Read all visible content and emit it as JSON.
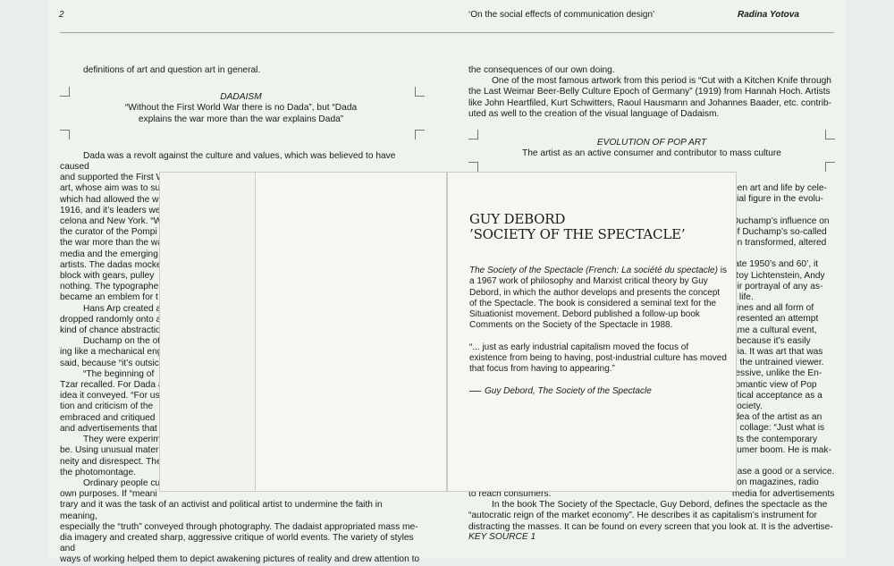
{
  "header": {
    "page_number": "2",
    "title": "‘On the social effects of communication design’",
    "author": "Radina Yotova"
  },
  "left": {
    "intro": "definitions of art and question art in general.",
    "dadaism_heading": "DADAISM",
    "dadaism_quote_1": "“Without the First World War there is no Dada”, but “Dada",
    "dadaism_quote_2": "explains the war more than the war explains Dada”",
    "lines": [
      "Dada was a revolt against the culture and values, which was believed to have caused",
      "and supported the First World War. (1914-18) It quickly developed into type of avant-gard",
      "art, whose aim was to su",
      "which had allowed the w",
      "1916, and it’s leaders we",
      "celona and New York. “W",
      "the curator of the Pompi",
      "the war more than the wa",
      "media and the emerging",
      "artists. The dadas mocke",
      "block with gears, pulley",
      "nothing. The typographe",
      "became an emblem for t",
      "Hans Arp created a",
      "dropped randomly onto a",
      "kind of chance abstractio",
      "Duchamp on the ot",
      "ing like a mechanical eng",
      "said, because “it’s outsic",
      "“The beginning of",
      "Tzar recalled. For Dada a",
      "idea it conveyed. “For us",
      "tion and criticism of the",
      "embraced and critiqued",
      "and advertisements that",
      "They were experim",
      "be. Using unusual materi",
      "neity and disrespect. The",
      "the photomontage.",
      "Ordinary people cu",
      "own purposes. If “meani",
      "trary and it was the task of an activist and political artist to undermine the faith in meaning,",
      "especially the “truth” conveyed through photography. The dadaist appropriated mass me-",
      "dia imagery and created sharp, aggressive critique of world events. The variety of styles and",
      "ways of working helped them to depict awakening pictures of reality and drew attention to"
    ]
  },
  "right": {
    "top_lines": [
      "the consequences of our own doing.",
      "One of the most famous artwork from this period is “Cut with a Kitchen Knife through",
      "the Last Weimar Beer-Belly Culture Epoch of Germany” (1919) from Hannah Hoch. Artists",
      "like John Heartfiled, Kurt Schwitters, Raoul Hausmann and Johannes Baader, etc. contrib-",
      "uted as well to the creation of the visual language of Dadaism."
    ],
    "pop_heading": "EVOLUTION OF POP ART",
    "pop_sub": "The artist as an active consumer and contributor to mass culture",
    "mid_lines": [
      "een art and life by cele-",
      "itial figure in the evolu-",
      "",
      "Duchamp’s influence on",
      "of Duchamp’s so-called",
      "en transformed, altered",
      "",
      "late 1950’s and 60’, it",
      "Roy Lichtenstein, Andy",
      "eir portrayal of any as-",
      "y life.",
      "zines and all form of",
      "presented an attempt",
      "ame a cultural event,",
      "l because it’s easily",
      "dia. It was art that was",
      "d the untrained viewer.",
      "ressive, unlike the En-",
      "romantic view of Pop",
      "ritical acceptance as a",
      "society.",
      "idea of the artist as an",
      "n collage: “Just what is",
      "cts the contemporary",
      "sumer boom. He is mak-",
      "",
      "hase a good or a service.",
      "tion magazines, radio",
      "media for advertisements"
    ],
    "bottom_lines": [
      "to reach consumers.",
      "In the book The Society of the Spectacle, Guy Debord, defines the spectacle as the",
      "“autocratic reign of the market economy”. He describes it as capitalism’s instrument for",
      "distracting the masses. It can be found on every screen that you look at. It is the advertise-"
    ],
    "key_source": "KEY SOURCE 1"
  },
  "card": {
    "title_1": "GUY DEBORD",
    "title_2": "’SOCIETY OF THE SPECTACLE’",
    "para_italic": "The Society of the Spectacle (French: La société du spectacle)",
    "para_rest": " is a 1967 work of philosophy and Marxist critical theory by Guy Debord, in which the author develops and presents the concept of the Spectacle. The book is considered a seminal text for the Situationist movement. Debord published a follow-up book Comments on the Society of the Spectacle in 1988.",
    "quote": "“... just as early industrial capitalism moved the focus of existence from being to having, post-industrial culture has moved that focus from having to appearing.”",
    "attribution": "Guy Debord, The Society of the Spectacle"
  }
}
